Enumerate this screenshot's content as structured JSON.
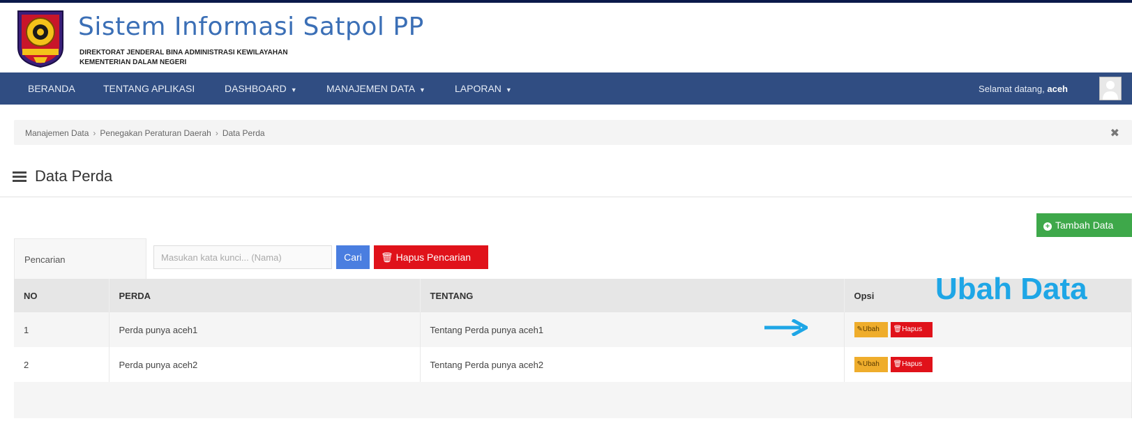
{
  "header": {
    "title": "Sistem Informasi Satpol PP",
    "subtitle_1": "DIREKTORAT JENDERAL BINA ADMINISTRASI KEWILAYAHAN",
    "subtitle_2": "KEMENTERIAN DALAM NEGERI",
    "logo_icon": "satpol-pp-emblem"
  },
  "nav": {
    "items": [
      {
        "label": "BERANDA",
        "has_caret": false
      },
      {
        "label": "TENTANG APLIKASI",
        "has_caret": false
      },
      {
        "label": "DASHBOARD",
        "has_caret": true
      },
      {
        "label": "MANAJEMEN DATA",
        "has_caret": true
      },
      {
        "label": "LAPORAN",
        "has_caret": true
      }
    ],
    "welcome_prefix": "Selamat datang,",
    "username": "aceh",
    "background": "#304d82"
  },
  "breadcrumb": {
    "items": [
      "Manajemen Data",
      "Penegakan Peraturan Daerah",
      "Data Perda"
    ],
    "separator": "›",
    "close_glyph": "✖"
  },
  "page": {
    "title": "Data Perda"
  },
  "actions": {
    "add_label": "Tambah Data"
  },
  "search": {
    "label": "Pencarian",
    "placeholder": "Masukan kata kunci... (Nama)",
    "value": "",
    "search_label": "Cari",
    "clear_label": "Hapus Pencarian"
  },
  "table": {
    "headers": [
      "NO",
      "PERDA",
      "TENTANG",
      "Opsi"
    ],
    "rows": [
      {
        "no": "1",
        "perda": "Perda punya aceh1",
        "tentang": "Tentang Perda punya aceh1",
        "edit_label": "Ubah",
        "delete_label": "Hapus"
      },
      {
        "no": "2",
        "perda": "Perda punya aceh2",
        "tentang": "Tentang Perda punya aceh2",
        "edit_label": "Ubah",
        "delete_label": "Hapus"
      }
    ]
  },
  "annotation": {
    "text": "Ubah Data",
    "color": "#1ea6e6"
  },
  "colors": {
    "accent_green": "#3ea84a",
    "accent_blue": "#4a7ee0",
    "danger_red": "#e0121a",
    "warning_orange": "#efad2c"
  }
}
